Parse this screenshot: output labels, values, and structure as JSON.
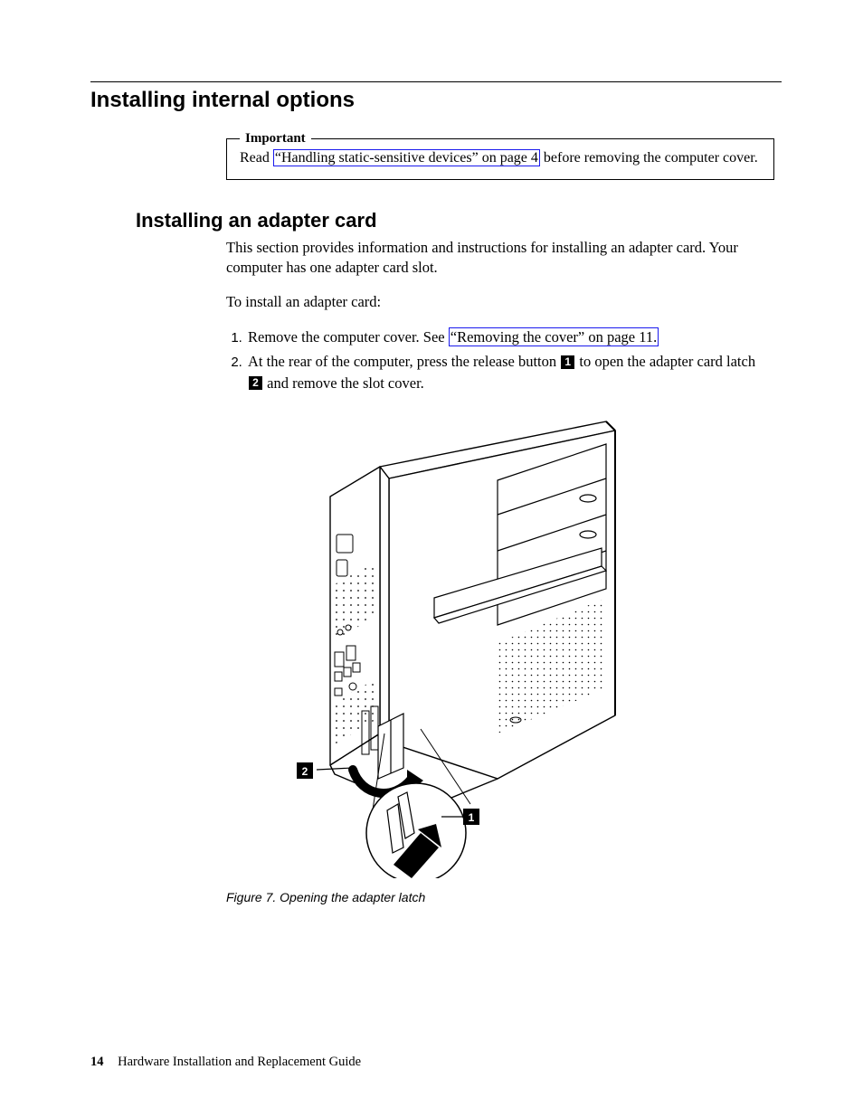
{
  "section_title": "Installing internal options",
  "callout": {
    "title": "Important",
    "before_link": "Read ",
    "link_text": "“Handling static-sensitive devices” on page 4",
    "after_link": " before removing the computer cover."
  },
  "subsection_title": "Installing an adapter card",
  "intro_paragraph": "This section provides information and instructions for installing an adapter card. Your computer has one adapter card slot.",
  "lead_in": "To install an adapter card:",
  "steps": [
    {
      "before_link": "Remove the computer cover. See ",
      "link_text": "“Removing the cover” on page 11.",
      "after_link": ""
    },
    {
      "segments": [
        {
          "text": "At the rear of the computer, press the release button "
        },
        {
          "callout_num": "1"
        },
        {
          "text": " to open the adapter card latch "
        },
        {
          "callout_num": "2"
        },
        {
          "text": " and remove the slot cover."
        }
      ]
    }
  ],
  "figure": {
    "callout_labels": {
      "one": "1",
      "two": "2"
    },
    "caption": "Figure 7. Opening the adapter latch"
  },
  "footer": {
    "page_number": "14",
    "book_title": "Hardware Installation and Replacement Guide"
  }
}
